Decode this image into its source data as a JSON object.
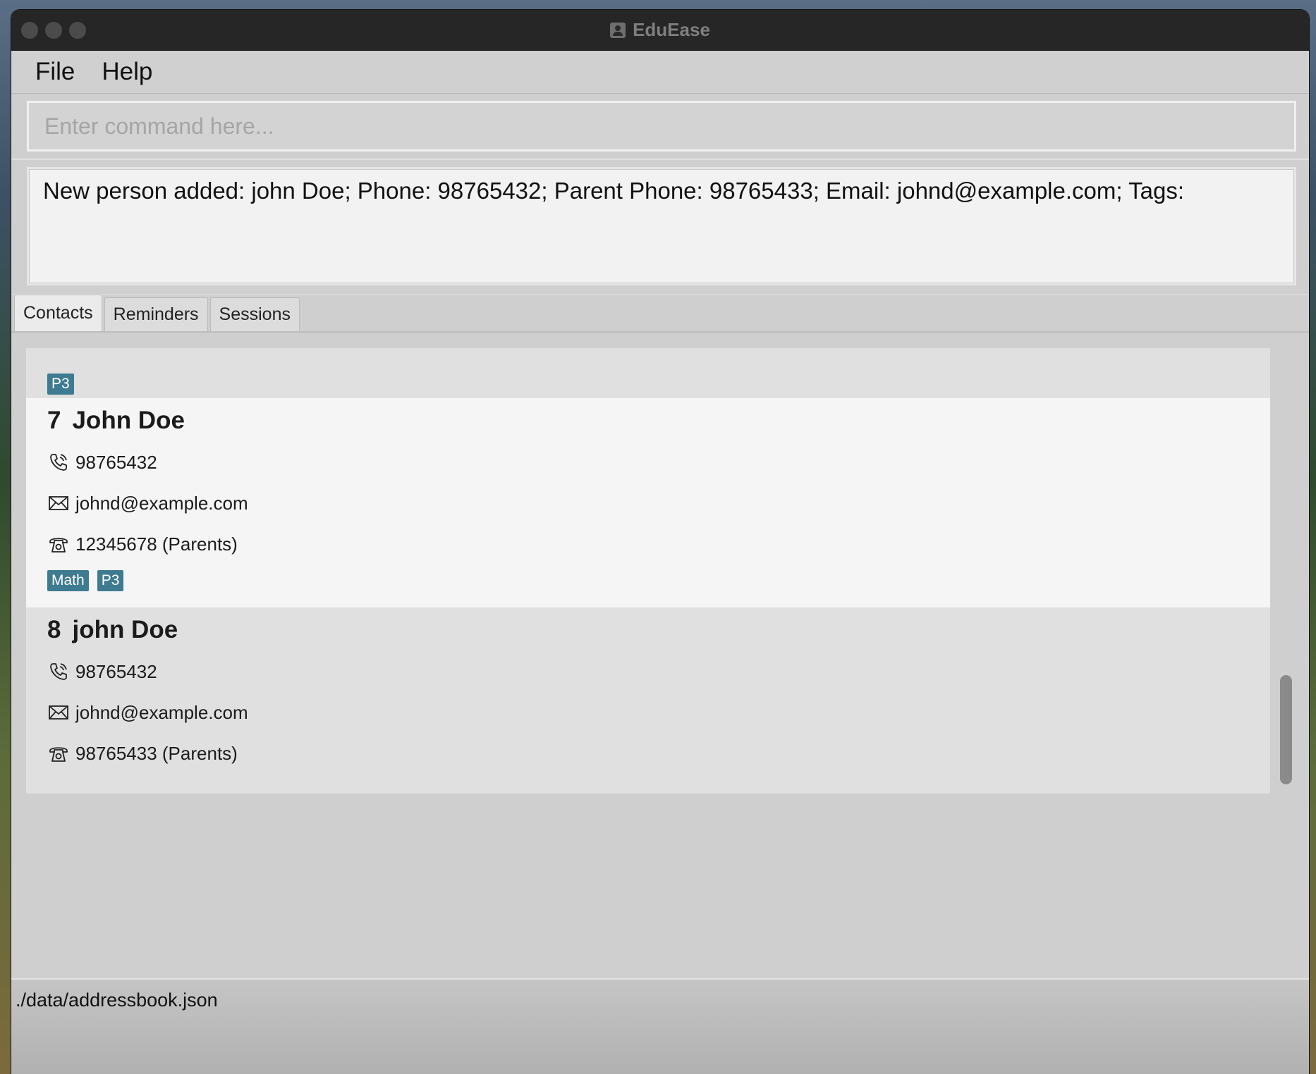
{
  "window": {
    "title": "EduEase"
  },
  "menu": {
    "items": [
      "File",
      "Help"
    ]
  },
  "command": {
    "placeholder": "Enter command here...",
    "value": ""
  },
  "result": {
    "text": "New person added: john Doe; Phone: 98765432; Parent Phone: 98765433; Email: johnd@example.com; Tags:"
  },
  "tabs": [
    {
      "label": "Contacts",
      "active": true
    },
    {
      "label": "Reminders",
      "active": false
    },
    {
      "label": "Sessions",
      "active": false
    }
  ],
  "contacts": {
    "partial_card": {
      "tags": [
        "P3"
      ]
    },
    "cards": [
      {
        "index": "7",
        "name": "John Doe",
        "phone": "98765432",
        "email": "johnd@example.com",
        "parent_phone": "12345678 (Parents)",
        "tags": [
          "Math",
          "P3"
        ]
      },
      {
        "index": "8",
        "name": "john Doe",
        "phone": "98765432",
        "email": "johnd@example.com",
        "parent_phone": "98765433 (Parents)",
        "tags": []
      }
    ]
  },
  "status": {
    "file_path": "./data/addressbook.json"
  },
  "icons": {
    "phone": "phone-icon",
    "email": "email-icon",
    "parent_phone": "telephone-icon",
    "app": "contact-icon"
  }
}
